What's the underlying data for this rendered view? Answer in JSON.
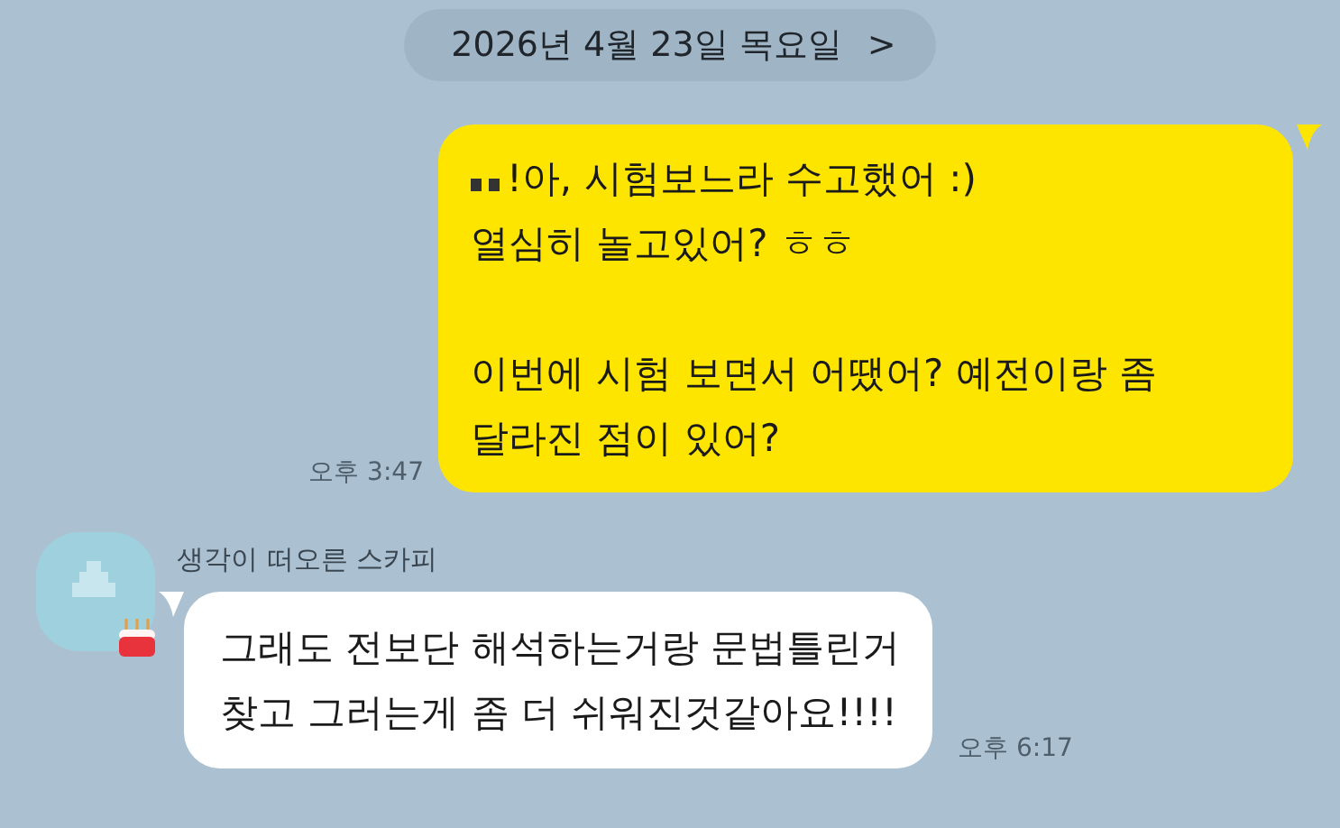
{
  "date_divider": {
    "label": "2026년 4월 23일 목요일",
    "arrow": ">"
  },
  "messages": [
    {
      "kind": "sent",
      "redacted_name": true,
      "paragraphs": [
        [
          "!아, 시험보느라 수고했어 :)",
          "열심히 놀고있어? ㅎㅎ"
        ],
        [
          "이번에 시험 보면서 어땠어? 예전이랑 좀",
          "달라진 점이 있어?"
        ]
      ],
      "time": "오후 3:47"
    },
    {
      "kind": "received",
      "sender": "생각이 떠오른 스카피",
      "birthday": true,
      "paragraphs": [
        [
          "그래도 전보단 해석하는거랑 문법틀린거",
          "찾고 그러는게 좀 더 쉬워진것같아요!!!!"
        ]
      ],
      "time": "오후 6:17"
    }
  ]
}
